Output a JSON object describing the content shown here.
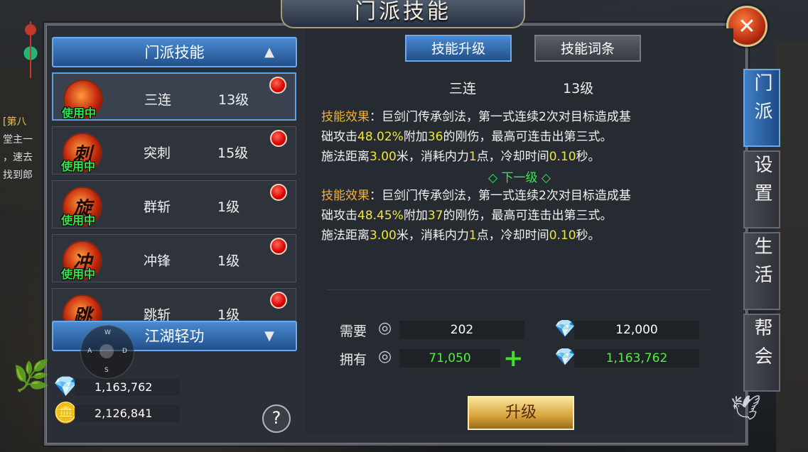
{
  "window": {
    "title": "门派技能"
  },
  "background": {
    "left_text": [
      "[第八",
      "堂主一",
      "，速去",
      "找到郎"
    ]
  },
  "left_panel": {
    "header_sect": "门派技能",
    "header_sect_arrow": "▲",
    "header_qinggong": "江湖轻功",
    "header_qinggong_arrow": "▼",
    "skills": [
      {
        "name": "三连",
        "level": "13级",
        "status": "使用中",
        "icon_char": "",
        "active": true
      },
      {
        "name": "突刺",
        "level": "15级",
        "status": "使用中",
        "icon_char": "刺",
        "active": false
      },
      {
        "name": "群斩",
        "level": "1级",
        "status": "使用中",
        "icon_char": "旋",
        "active": false
      },
      {
        "name": "冲锋",
        "level": "1级",
        "status": "使用中",
        "icon_char": "冲",
        "active": false
      },
      {
        "name": "跳斩",
        "level": "1级",
        "status": "",
        "icon_char": "跳",
        "active": false
      }
    ],
    "currencies": [
      {
        "icon": "gem-icon",
        "value": "1,163,762"
      },
      {
        "icon": "coin-icon",
        "value": "2,126,841"
      }
    ],
    "help": "?"
  },
  "joystick": {
    "n": "W",
    "w": "A",
    "e": "D",
    "s": "S"
  },
  "right_panel": {
    "tabs": [
      {
        "label": "技能升级",
        "active": true
      },
      {
        "label": "技能词条",
        "active": false
      }
    ],
    "skill_name": "三连",
    "skill_level": "13级",
    "current": {
      "effect_label": "技能效果",
      "line1a": "：巨剑门传承剑法，第一式连续2次对目标造成基",
      "line2a": "础攻击",
      "pct": "48.02%",
      "line2b": "附加",
      "dmg": "36",
      "line2c": "的刚伤，最高可连击出第三式。",
      "line3a": "施法距离",
      "dist": "3.00",
      "line3b": "米，消耗内力",
      "cost": "1",
      "line3c": "点，冷却时间",
      "cd": "0.10",
      "line3d": "秒。"
    },
    "next_level_label": "◇ 下一级 ◇",
    "next": {
      "effect_label": "技能效果",
      "line1a": "：巨剑门传承剑法，第一式连续2次对目标造成基",
      "line2a": "础攻击",
      "pct": "48.45%",
      "line2b": "附加",
      "dmg": "37",
      "line2c": "的刚伤，最高可连击出第三式。",
      "line3a": "施法距离",
      "dist": "3.00",
      "line3b": "米，消耗内力",
      "cost": "1",
      "line3c": "点，冷却时间",
      "cd": "0.10",
      "line3d": "秒。"
    },
    "need_label": "需要",
    "have_label": "拥有",
    "need_silver": "202",
    "need_gem": "12,000",
    "have_silver": "71,050",
    "have_gem": "1,163,762",
    "plus": "+",
    "upgrade_label": "升级"
  },
  "side_tabs": [
    {
      "label": "门派",
      "active": true
    },
    {
      "label": "设置",
      "active": false
    },
    {
      "label": "生活",
      "active": false
    },
    {
      "label": "帮会",
      "active": false
    }
  ],
  "colors": {
    "accent_blue": "#4a8ad1",
    "highlight_yellow": "#f2e43a",
    "label_orange": "#f2b134",
    "green": "#32e856"
  }
}
